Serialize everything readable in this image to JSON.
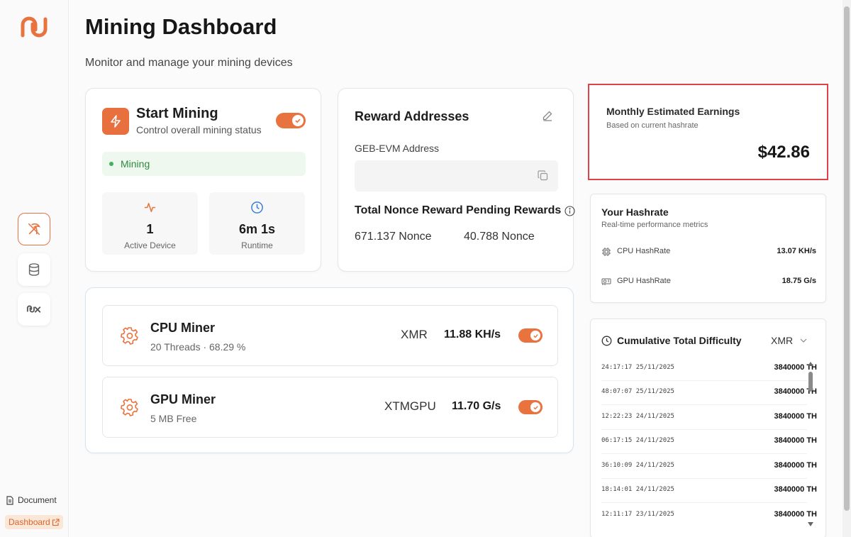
{
  "app": {
    "title": "Mining Dashboard",
    "subtitle": "Monitor and manage your mining devices",
    "accent": "#e8733f"
  },
  "sidebar": {
    "logo": "miner-logo",
    "items": [
      {
        "icon": "pickaxe-icon",
        "active": true
      },
      {
        "icon": "database-icon",
        "active": false
      },
      {
        "icon": "brand-nx-icon",
        "active": false
      }
    ],
    "document_label": "Document",
    "dashboard_label": "Dashboard"
  },
  "start_mining": {
    "title": "Start Mining",
    "subtitle": "Control overall mining status",
    "enabled": true,
    "status": "Mining",
    "stats": [
      {
        "icon": "activity-icon",
        "value": "1",
        "label": "Active Device"
      },
      {
        "icon": "clock-icon",
        "value": "6m 1s",
        "label": "Runtime"
      }
    ]
  },
  "reward": {
    "title": "Reward Addresses",
    "address_label": "GEB-EVM Address",
    "address_value": "",
    "pending_title": "Total Nonce Reward Pending Rewards",
    "total": "671.137 Nonce",
    "pending": "40.788 Nonce"
  },
  "miners": [
    {
      "name": "CPU Miner",
      "detail": "20 Threads · 68.29 %",
      "coin": "XMR",
      "rate": "11.88 KH/s",
      "enabled": true
    },
    {
      "name": "GPU Miner",
      "detail": "5 MB Free",
      "coin": "XTMGPU",
      "rate": "11.70 G/s",
      "enabled": true
    }
  ],
  "earnings": {
    "title": "Monthly Estimated Earnings",
    "subtitle": "Based on current hashrate",
    "value": "$42.86",
    "highlight_color": "#e0424d"
  },
  "hashrate": {
    "title": "Your Hashrate",
    "subtitle": "Real-time performance metrics",
    "rows": [
      {
        "icon": "cpu-icon",
        "label": "CPU HashRate",
        "value": "13.07 KH/s"
      },
      {
        "icon": "gpu-icon",
        "label": "GPU HashRate",
        "value": "18.75 G/s"
      }
    ]
  },
  "difficulty": {
    "title": "Cumulative Total Difficulty",
    "coin": "XMR",
    "rows": [
      {
        "time": "24:17:17 25/11/2025",
        "value": "3840000 TH"
      },
      {
        "time": "48:07:07 25/11/2025",
        "value": "3840000 TH"
      },
      {
        "time": "12:22:23 24/11/2025",
        "value": "3840000 TH"
      },
      {
        "time": "06:17:15 24/11/2025",
        "value": "3840000 TH"
      },
      {
        "time": "36:10:09 24/11/2025",
        "value": "3840000 TH"
      },
      {
        "time": "18:14:01 24/11/2025",
        "value": "3840000 TH"
      },
      {
        "time": "12:11:17 23/11/2025",
        "value": "3840000 TH"
      }
    ]
  }
}
